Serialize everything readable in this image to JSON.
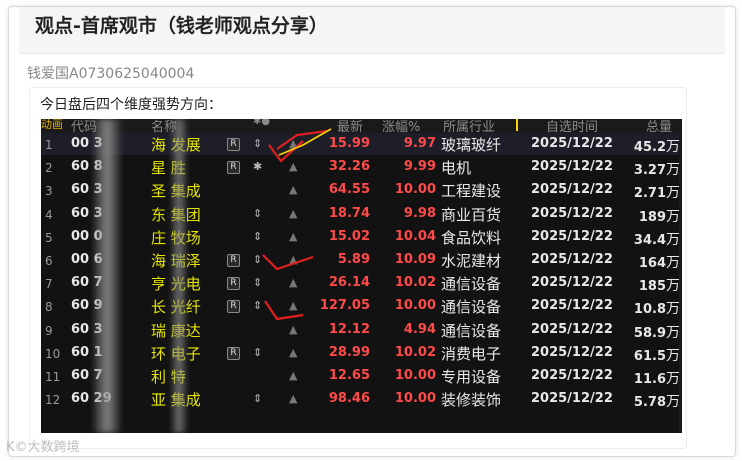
{
  "page": {
    "title": "观点-首席观市（钱老师观点分享）",
    "author": "钱爱国A0730625040004",
    "heading": "今日盘后四个维度强势方向："
  },
  "table": {
    "headers": [
      "动画",
      "代码",
      "名称",
      "",
      "最新",
      "涨幅%",
      "所属行业",
      "自选时间",
      "总量"
    ],
    "rows": [
      {
        "idx": "1",
        "code": "00 3",
        "name": "海  发展",
        "tag": "R",
        "flag": "⇕",
        "price": "15.99",
        "chg": "9.97",
        "industry": "玻璃玻纤",
        "date": "2025/12/22",
        "vol_num": "45.2",
        "vol_unit": "万"
      },
      {
        "idx": "2",
        "code": "60 8",
        "name": "星  胜",
        "tag": "R",
        "flag": "✱",
        "price": "32.26",
        "chg": "9.99",
        "industry": "电机",
        "date": "2025/12/22",
        "vol_num": "3.27",
        "vol_unit": "万"
      },
      {
        "idx": "3",
        "code": "60 3",
        "name": "圣  集成",
        "tag": "",
        "flag": "",
        "price": "64.55",
        "chg": "10.00",
        "industry": "工程建设",
        "date": "2025/12/22",
        "vol_num": "2.71",
        "vol_unit": "万"
      },
      {
        "idx": "4",
        "code": "60 3",
        "name": "东  集团",
        "tag": "",
        "flag": "⇕",
        "price": "18.74",
        "chg": "9.98",
        "industry": "商业百货",
        "date": "2025/12/22",
        "vol_num": "189",
        "vol_unit": "万"
      },
      {
        "idx": "5",
        "code": "00 0",
        "name": "庄  牧场",
        "tag": "",
        "flag": "⇕",
        "price": "15.02",
        "chg": "10.04",
        "industry": "食品饮料",
        "date": "2025/12/22",
        "vol_num": "34.4",
        "vol_unit": "万"
      },
      {
        "idx": "6",
        "code": "00 6",
        "name": "海  瑞泽",
        "tag": "R",
        "flag": "⇕",
        "price": "5.89",
        "chg": "10.09",
        "industry": "水泥建材",
        "date": "2025/12/22",
        "vol_num": "164",
        "vol_unit": "万"
      },
      {
        "idx": "7",
        "code": "60 7",
        "name": "亨  光电",
        "tag": "R",
        "flag": "⇕",
        "price": "26.14",
        "chg": "10.02",
        "industry": "通信设备",
        "date": "2025/12/22",
        "vol_num": "185",
        "vol_unit": "万"
      },
      {
        "idx": "8",
        "code": "60 9",
        "name": "长  光纤",
        "tag": "R",
        "flag": "⇕",
        "price": "127.05",
        "chg": "10.00",
        "industry": "通信设备",
        "date": "2025/12/22",
        "vol_num": "10.8",
        "vol_unit": "万"
      },
      {
        "idx": "9",
        "code": "60 3",
        "name": "瑞  康达",
        "tag": "",
        "flag": "",
        "price": "12.12",
        "chg": "4.94",
        "industry": "通信设备",
        "date": "2025/12/22",
        "vol_num": "58.9",
        "vol_unit": "万"
      },
      {
        "idx": "10",
        "code": "60 1",
        "name": "环  电子",
        "tag": "R",
        "flag": "⇕",
        "price": "28.99",
        "chg": "10.02",
        "industry": "消费电子",
        "date": "2025/12/22",
        "vol_num": "61.5",
        "vol_unit": "万"
      },
      {
        "idx": "11",
        "code": "60 7",
        "name": "利  特",
        "tag": "",
        "flag": "",
        "price": "12.65",
        "chg": "10.00",
        "industry": "专用设备",
        "date": "2025/12/22",
        "vol_num": "11.6",
        "vol_unit": "万"
      },
      {
        "idx": "12",
        "code": "60 29",
        "name": "亚  集成",
        "tag": "",
        "flag": "⇕",
        "price": "98.46",
        "chg": "10.00",
        "industry": "装修装饰",
        "date": "2025/12/22",
        "vol_num": "5.78",
        "vol_unit": "万"
      }
    ]
  },
  "watermark": "K©大数跨境",
  "colors": {
    "up": "#ff4a4a",
    "name": "#e6e600",
    "background": "#121212",
    "check": "#e02020"
  }
}
